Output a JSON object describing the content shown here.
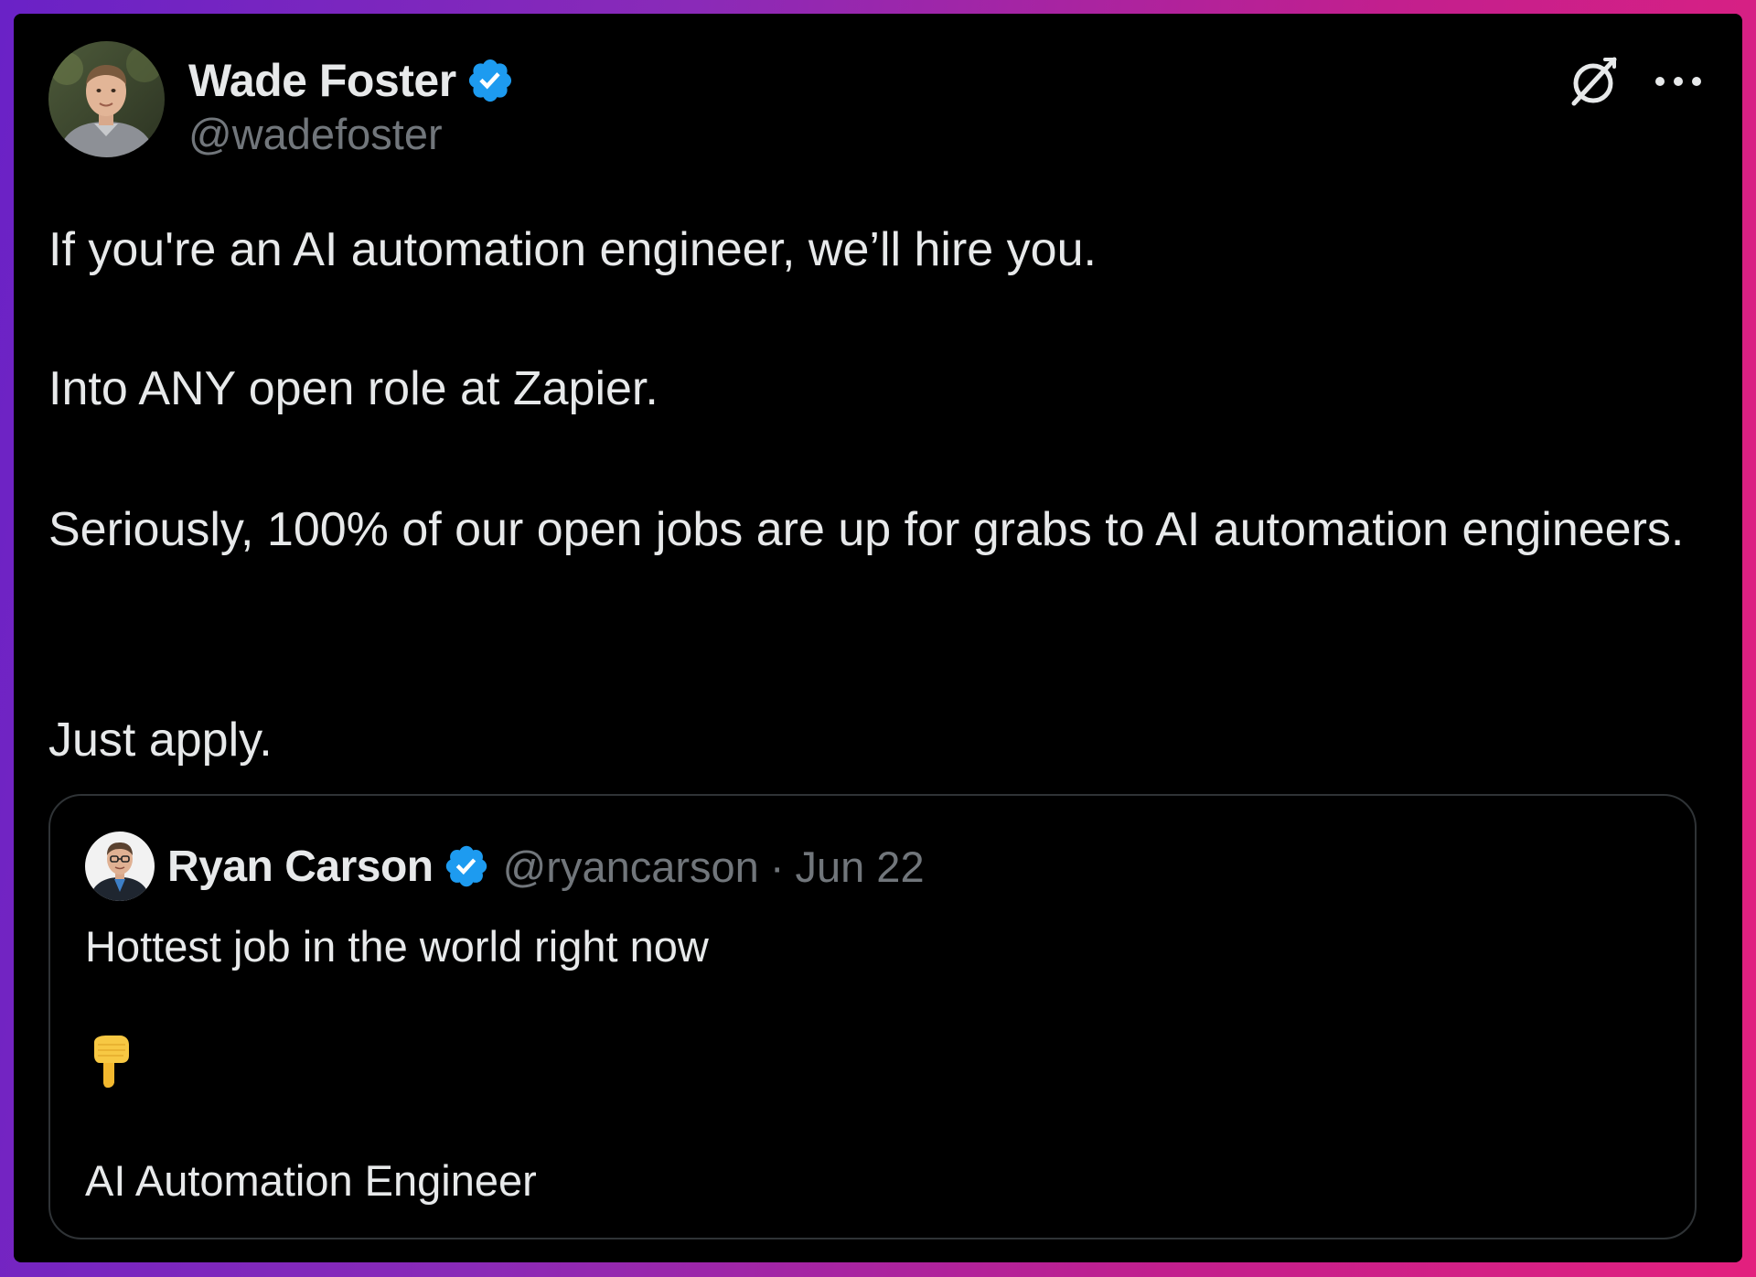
{
  "author": {
    "display_name": "Wade Foster",
    "handle": "@wadefoster",
    "verified": true
  },
  "icons": {
    "verified": "verified-badge-icon",
    "grok": "grok-icon",
    "more": "more-icon",
    "emoji": "backhand-index-pointing-down-emoji"
  },
  "tweet": {
    "paragraphs": [
      "If you're an AI automation engineer, we’ll hire you.",
      "Into ANY open role at Zapier.",
      "Seriously, 100% of our open jobs are up for grabs to AI automation engineers.",
      "Just apply."
    ]
  },
  "quoted_tweet": {
    "display_name": "Ryan Carson",
    "handle": "@ryancarson",
    "separator": "·",
    "date": "Jun 22",
    "verified": true,
    "line1": "Hottest job in the world right now",
    "line3": "AI Automation Engineer"
  },
  "colors": {
    "background_gradient_start": "#6a22c6",
    "background_gradient_end": "#e3207e",
    "card": "#000000",
    "text_primary": "#e7e9ea",
    "text_secondary": "#71767b",
    "verified_blue": "#1d9bf0",
    "border": "#2f3336"
  }
}
